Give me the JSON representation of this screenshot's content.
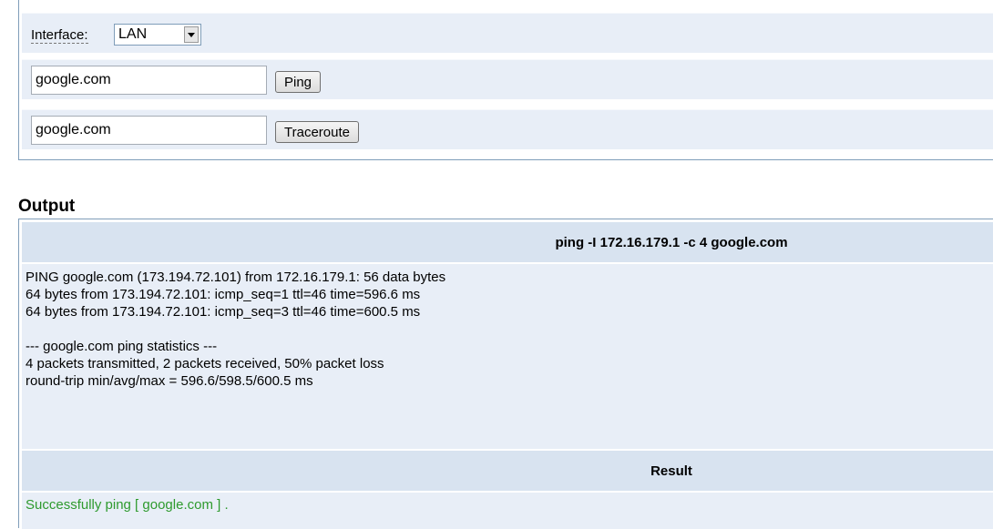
{
  "tools": {
    "interface_label": "Interface:",
    "interface_value": "LAN",
    "ping_host": "google.com",
    "ping_button": "Ping",
    "trace_host": "google.com",
    "trace_button": "Traceroute"
  },
  "output": {
    "heading": "Output",
    "command": "ping -I 172.16.179.1 -c 4 google.com",
    "lines": [
      "PING google.com (173.194.72.101) from 172.16.179.1: 56 data bytes",
      "64 bytes from 173.194.72.101: icmp_seq=1 ttl=46 time=596.6 ms",
      "64 bytes from 173.194.72.101: icmp_seq=3 ttl=46 time=600.5 ms",
      "",
      "--- google.com ping statistics ---",
      "4 packets transmitted, 2 packets received, 50% packet loss",
      "round-trip min/avg/max = 596.6/598.5/600.5 ms"
    ],
    "result_header": "Result",
    "result_message": "Successfully ping [ google.com ] ."
  },
  "colors": {
    "row_bg": "#e8eef7",
    "header_bg": "#d8e3f0",
    "border": "#7f9db9",
    "success_text": "#2e9a2e"
  }
}
